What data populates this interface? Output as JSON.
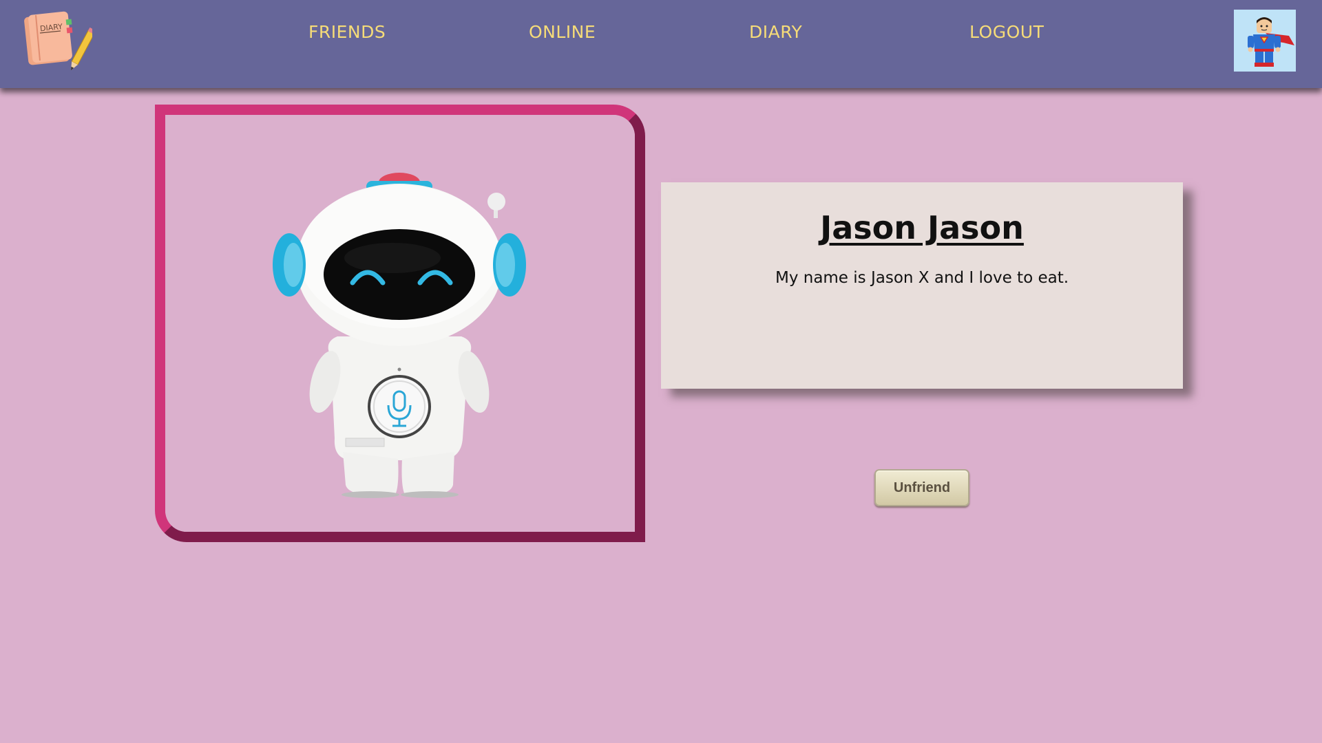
{
  "nav": {
    "logo_icon": "diary-book-with-pencil-icon",
    "logo_text": "DIARY",
    "links": [
      {
        "label": "FRIENDS"
      },
      {
        "label": "ONLINE"
      },
      {
        "label": "DIARY"
      },
      {
        "label": "LOGOUT"
      }
    ],
    "avatar_icon": "superhero-lego-figure-avatar"
  },
  "profile": {
    "photo_icon": "white-robot-with-headphones-image",
    "name": "Jason Jason",
    "bio": "My name is Jason X and I love to eat.",
    "unfriend_label": "Unfriend"
  },
  "colors": {
    "page_background": "#dbb0cd",
    "navbar": "#666699",
    "nav_text": "#f6dc78",
    "frame_light": "#d0357a",
    "frame_dark": "#7f1c4b",
    "card_background": "#e8dedb",
    "button_background": "#e4dcbc"
  }
}
